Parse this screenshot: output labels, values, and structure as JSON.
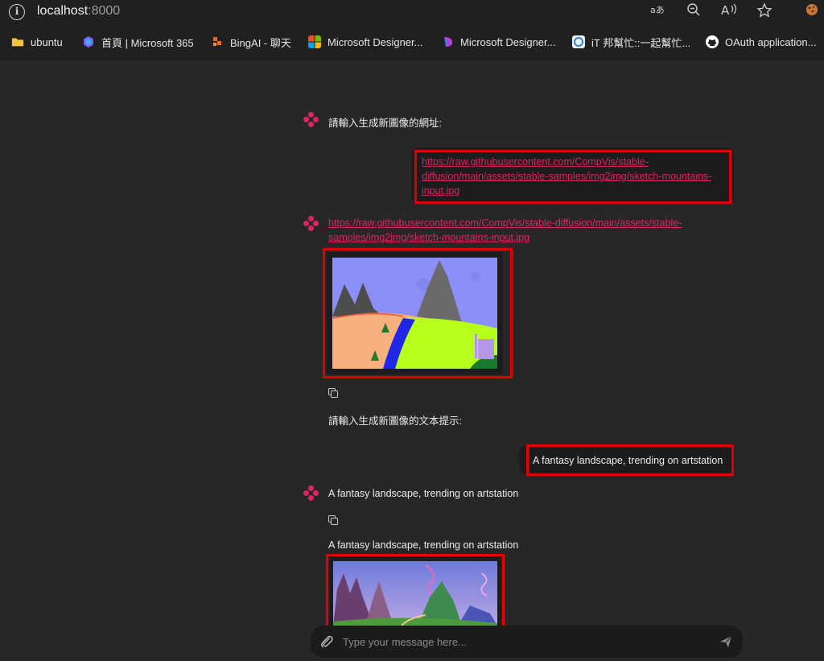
{
  "browser": {
    "url_host": "localhost",
    "url_port": ":8000",
    "toolbar_icons": [
      "translate-icon",
      "zoom-icon",
      "read-aloud-icon",
      "favorite-icon",
      "extension-icon"
    ],
    "bookmarks": [
      {
        "label": "ubuntu",
        "icon": "folder-icon",
        "color": "#f4c542"
      },
      {
        "label": "首頁 | Microsoft 365",
        "icon": "m365-icon",
        "color": "#7b61ff"
      },
      {
        "label": "BingAI - 聊天",
        "icon": "bing-icon",
        "color": "#f26522"
      },
      {
        "label": "Microsoft Designer...",
        "icon": "microsoft-icon",
        "color": "#f25022"
      },
      {
        "label": "Microsoft Designer...",
        "icon": "designer-icon",
        "color": "#c43ad6"
      },
      {
        "label": "iT 邦幫忙::一起幫忙...",
        "icon": "ithome-icon",
        "color": "#3b82c4"
      },
      {
        "label": "OAuth application...",
        "icon": "github-icon",
        "color": "#ffffff"
      }
    ]
  },
  "chat": {
    "prompt_url": "請輸入生成新圖像的網址:",
    "user_url": "https://raw.githubusercontent.com/CompVis/stable-diffusion/main/assets/stable-samples/img2img/sketch-mountains-input.jpg",
    "user_url_lines": [
      "https://raw.githubusercontent.com/CompVis/stable-",
      "diffusion/main/assets/stable-samples/img2img/sketch-mountains-",
      "input.jpg"
    ],
    "bot_url_lines": [
      "https://raw.githubusercontent.com/CompVis/stable-diffusion/main/assets/stable-",
      "samples/img2img/sketch-mountains-input.jpg"
    ],
    "prompt_text": "請輸入生成新圖像的文本提示:",
    "user_text": "A fantasy landscape, trending on artstation",
    "bot_echo": "A fantasy landscape, trending on artstation",
    "result_caption": "A fantasy landscape, trending on artstation",
    "accent_color": "#e0245e",
    "highlight_color": "#e00000"
  },
  "composer": {
    "placeholder": "Type your message here...",
    "attach_icon": "paperclip-icon",
    "send_icon": "send-icon"
  }
}
